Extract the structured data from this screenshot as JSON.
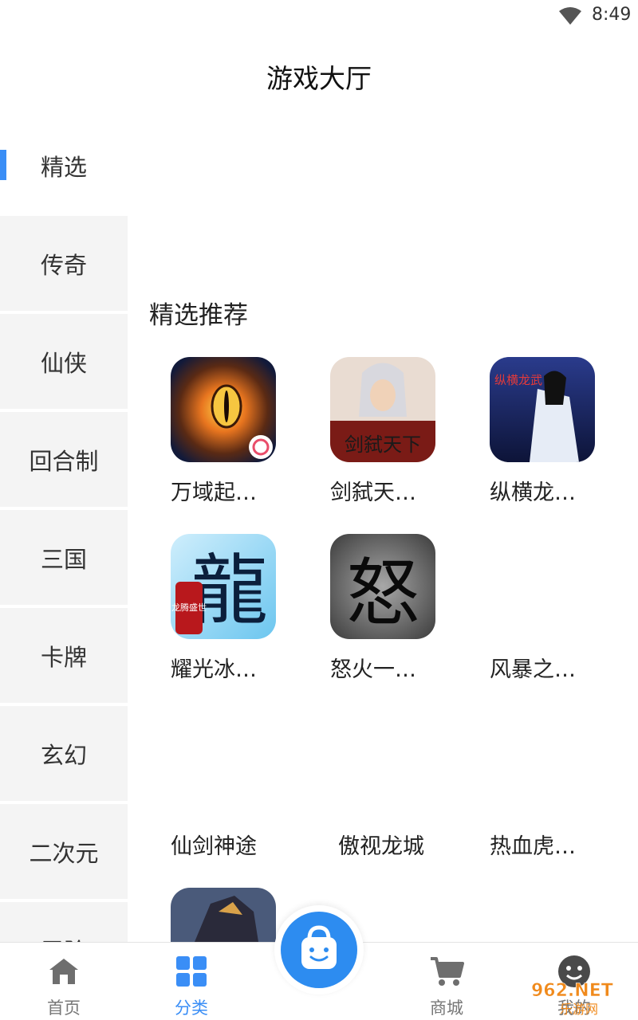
{
  "status_bar": {
    "time": "8:49"
  },
  "title": "游戏大厅",
  "sidebar": {
    "items": [
      {
        "label": "精选"
      },
      {
        "label": "传奇"
      },
      {
        "label": "仙侠"
      },
      {
        "label": "回合制"
      },
      {
        "label": "三国"
      },
      {
        "label": "卡牌"
      },
      {
        "label": "玄幻"
      },
      {
        "label": "二次元"
      },
      {
        "label": "冒险"
      }
    ]
  },
  "section": {
    "title": "精选推荐",
    "games": [
      {
        "name": "万域起…"
      },
      {
        "name": "剑弑天…"
      },
      {
        "name": "纵横龙…"
      },
      {
        "name": "耀光冰…"
      },
      {
        "name": "怒火一…"
      },
      {
        "name": "风暴之…"
      },
      {
        "name": "仙剑神途"
      },
      {
        "name": "傲视龙城"
      },
      {
        "name": "热血虎…"
      }
    ],
    "icon_text": {
      "game2_logo": "剑弑天下",
      "game3_logo": "纵横龙武",
      "game4_big": "龍",
      "game4_seal": "龙腾盛世",
      "game5_big": "怒"
    }
  },
  "bottom_nav": {
    "items": [
      {
        "label": "首页",
        "icon": "home-icon"
      },
      {
        "label": "分类",
        "icon": "grid-icon"
      },
      {
        "label": "商城",
        "icon": "cart-icon"
      },
      {
        "label": "我的",
        "icon": "smile-icon"
      }
    ],
    "center_icon": "shopping-bag-icon"
  },
  "watermark": "962.NET 乐游网",
  "colors": {
    "accent": "#3a8ef6",
    "sidebar_bg": "#f4f4f4",
    "center_button": "#2d8cf0"
  }
}
